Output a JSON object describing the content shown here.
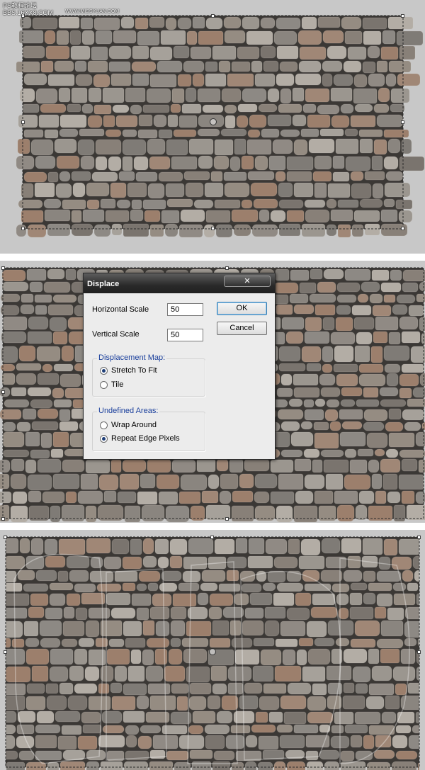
{
  "watermark": {
    "title": "PS教程论坛",
    "subtitle": "BBS.16XX8.COM",
    "site": "WWW.MISSYUAN.COM"
  },
  "dialog": {
    "title": "Displace",
    "close_label": "✕",
    "horizontal_scale": {
      "label": "Horizontal Scale",
      "value": "50"
    },
    "vertical_scale": {
      "label": "Vertical Scale",
      "value": "50"
    },
    "ok_label": "OK",
    "cancel_label": "Cancel",
    "displacement_map": {
      "label": "Displacement Map:",
      "options": [
        {
          "label": "Stretch To Fit",
          "checked": true
        },
        {
          "label": "Tile",
          "checked": false
        }
      ]
    },
    "undefined_areas": {
      "label": "Undefined Areas:",
      "options": [
        {
          "label": "Wrap Around",
          "checked": false
        },
        {
          "label": "Repeat Edge Pixels",
          "checked": true
        }
      ]
    }
  },
  "colors": {
    "canvas_gray": "#c8c8c8",
    "mortar": "#3b3835",
    "stone_base": "#8c8780",
    "stone_warm": "#9a7c68",
    "group_label_blue": "#1a3f9c"
  }
}
